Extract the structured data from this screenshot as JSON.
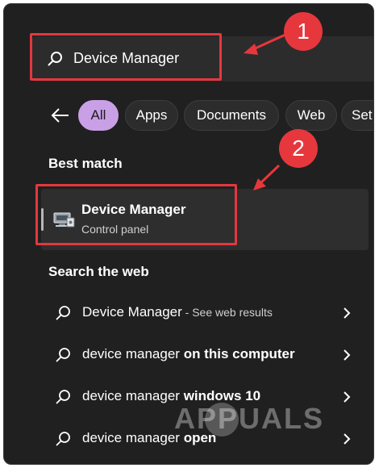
{
  "search": {
    "value": "Device Manager"
  },
  "annotations": {
    "step1": "1",
    "step2": "2"
  },
  "filters": [
    {
      "label": "All",
      "active": true
    },
    {
      "label": "Apps"
    },
    {
      "label": "Documents"
    },
    {
      "label": "Web"
    },
    {
      "label": "Set"
    }
  ],
  "best_match": {
    "heading": "Best match",
    "title": "Device Manager",
    "subtitle": "Control panel"
  },
  "web": {
    "heading": "Search the web",
    "rows": [
      {
        "prefix": "Device Manager",
        "bold": "",
        "suffix": " - See web results"
      },
      {
        "prefix": "device manager ",
        "bold": "on this computer",
        "suffix": ""
      },
      {
        "prefix": "device manager ",
        "bold": "windows 10",
        "suffix": ""
      },
      {
        "prefix": "device manager ",
        "bold": "open",
        "suffix": ""
      }
    ]
  },
  "watermark": "APPUALS",
  "colors": {
    "accent_chip": "#c9a0e6",
    "annotation_red": "#e6373d",
    "panel_bg": "#202020"
  }
}
